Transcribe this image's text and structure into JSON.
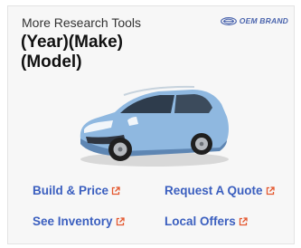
{
  "widget": {
    "subtitle": "More Research Tools",
    "title_line1": "(Year)(Make)",
    "title_line2": "(Model)",
    "brand": {
      "label": "OEM BRAND",
      "icon": "brand-logo-icon"
    },
    "image": {
      "icon": "car-image",
      "body_color": "#8fb8e0"
    },
    "links": [
      {
        "label": "Build & Price",
        "icon": "external-link-icon"
      },
      {
        "label": "Request A Quote",
        "icon": "external-link-icon"
      },
      {
        "label": "See Inventory",
        "icon": "external-link-icon"
      },
      {
        "label": "Local Offers",
        "icon": "external-link-icon"
      }
    ],
    "colors": {
      "link": "#3b5fbf",
      "accent_icon": "#e4572e",
      "brand": "#4a64ad"
    }
  }
}
